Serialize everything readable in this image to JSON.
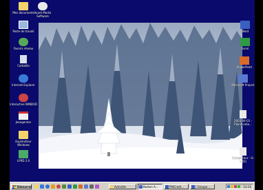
{
  "desktop": {
    "left_icons": [
      {
        "label": "Mes documents",
        "icon": "folder-icon",
        "color": "#f2d36b"
      },
      {
        "label": "Avant Media Software",
        "icon": "satellite-icon",
        "color": "#e8e8e8"
      },
      {
        "label": "Poste de travail",
        "icon": "computer-icon",
        "color": "#9ab7e0"
      },
      {
        "label": "Favoris réseau",
        "icon": "network-icon",
        "color": "#58a85a"
      },
      {
        "label": "Corbeille",
        "icon": "recycle-bin-icon",
        "color": "#d8e0ec"
      },
      {
        "label": "Internet Explorer",
        "icon": "internet-explorer-icon",
        "color": "#3a7ad8"
      },
      {
        "label": "Interactive WINDVD",
        "icon": "dvd-icon",
        "color": "#c44"
      },
      {
        "label": "Jeeegenten",
        "icon": "calendar-icon",
        "color": "#f0f0f0"
      },
      {
        "label": "Explorateur Windows",
        "icon": "explorer-icon",
        "color": "#f2d36b"
      },
      {
        "label": "LPRD 2.0",
        "icon": "app-icon",
        "color": "#4caa66"
      }
    ],
    "right_icons": [
      {
        "label": "Word",
        "icon": "word-icon",
        "color": "#3b5fc0"
      },
      {
        "label": "Excel",
        "icon": "excel-icon",
        "color": "#2f9a44"
      },
      {
        "label": "PowerPoint",
        "icon": "powerpoint-icon",
        "color": "#d86a2a"
      },
      {
        "label": "Microsoft Project",
        "icon": "project-icon",
        "color": "#5a7ad0"
      },
      {
        "label": "2003-04-01 - Planificatio...",
        "icon": "document-icon",
        "color": "#e8e8e8"
      },
      {
        "label": "Compléteur - G-v (D)",
        "icon": "shortcut-icon",
        "color": "#e8e8e8"
      }
    ]
  },
  "taskbar": {
    "start_label": "Démarrer",
    "tasks": [
      {
        "label": "Activités",
        "active": false
      },
      {
        "label": "Boston A...",
        "active": true
      },
      {
        "label": "PfdCrad/...",
        "active": false
      },
      {
        "label": "| Groupe...",
        "active": false
      }
    ],
    "clock": "11:11"
  },
  "colors": {
    "desktop_bg": "#0a0a6c",
    "taskbar_bg": "#d4d0c8"
  }
}
